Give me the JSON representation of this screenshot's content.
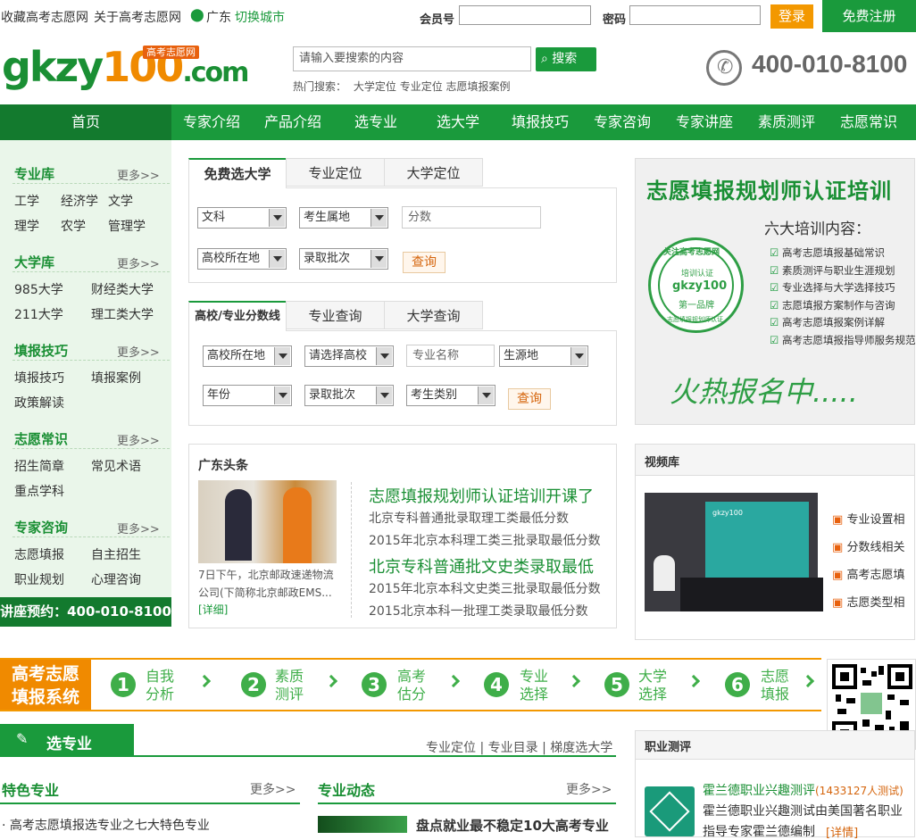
{
  "topbar": {
    "fav": "收藏高考志愿网",
    "about": "关于高考志愿网",
    "city": "广东",
    "switch_city": "切换城市",
    "member_label": "会员号",
    "password_label": "密码",
    "login": "登录",
    "register": "免费注册"
  },
  "header": {
    "logo_text_a": "gkzy",
    "logo_text_b": "100",
    "logo_text_c": ".com",
    "logo_tag": "高考志愿网",
    "search_placeholder": "请输入要搜索的内容",
    "search_button": "搜索",
    "hot_label": "热门搜索：",
    "hot_links": [
      "大学定位",
      "专业定位",
      "志愿填报案例"
    ],
    "phone": "400-010-8100"
  },
  "nav": {
    "home": "首页",
    "items": [
      "专家介绍",
      "产品介绍",
      "选专业",
      "选大学",
      "填报技巧",
      "专家咨询",
      "专家讲座",
      "素质测评",
      "志愿常识"
    ]
  },
  "sidebar": {
    "more": "更多>>",
    "sections": [
      {
        "title": "专业库",
        "links": [
          "工学",
          "经济学",
          "文学",
          "理学",
          "农学",
          "管理学"
        ]
      },
      {
        "title": "大学库",
        "links": [
          "985大学",
          "财经类大学",
          "211大学",
          "理工类大学"
        ]
      },
      {
        "title": "填报技巧",
        "links": [
          "填报技巧",
          "填报案例",
          "政策解读"
        ]
      },
      {
        "title": "志愿常识",
        "links": [
          "招生简章",
          "常见术语",
          "重点学科"
        ]
      },
      {
        "title": "专家咨询",
        "links": [
          "志愿填报",
          "自主招生",
          "职业规划",
          "心理咨询"
        ]
      }
    ],
    "footer": "讲座预约：400-010-8100"
  },
  "query1": {
    "tabs": [
      "免费选大学",
      "专业定位",
      "大学定位"
    ],
    "selects": [
      "文科",
      "考生属地",
      "高校所在地",
      "录取批次"
    ],
    "score_placeholder": "分数",
    "button": "查询"
  },
  "query2": {
    "tabs": [
      "高校/专业分数线",
      "专业查询",
      "大学查询"
    ],
    "selects": [
      "高校所在地",
      "请选择高校",
      "生源地",
      "年份",
      "录取批次",
      "考生类别"
    ],
    "major_placeholder": "专业名称",
    "button": "查询"
  },
  "news": {
    "title": "广东头条",
    "caption": "7日下午，北京邮政速递物流公司(下简称北京邮政EMS...",
    "detail": "[详细]",
    "headline1": "志愿填报规划师认证培训开课了",
    "headline2": "北京专科普通批文史类录取最低",
    "items1": [
      "北京专科普通批录取理工类最低分数",
      "2015年北京本科理工类三批录取最低分数"
    ],
    "items2": [
      "2015年北京本科文史类三批录取最低分数",
      "2015北京本科一批理工类录取最低分数"
    ]
  },
  "ad": {
    "title": "志愿填报规划师认证培训",
    "subtitle": "六大培训内容：",
    "items": [
      "高考志愿填报基础常识",
      "素质测评与职业生涯规划",
      "专业选择与大学选择技巧",
      "志愿填报方案制作与咨询",
      "高考志愿填报案例详解",
      "高考志愿填报指导师服务规范"
    ],
    "seal_top": "关注高考志愿网",
    "seal_mid": "培训认证",
    "seal_logo": "gkzy100",
    "seal_bottom": "第一品牌",
    "seal_ring": "志愿填报规划师认证",
    "cta": "火热报名中....."
  },
  "video": {
    "title": "视频库",
    "screen_logo": "gkzy100",
    "links": [
      "专业设置相",
      "分数线相关",
      "高考志愿填",
      "志愿类型相"
    ]
  },
  "banner": {
    "title_line1": "高考志愿",
    "title_line2": "填报系统",
    "steps": [
      {
        "num": "1",
        "a": "自我",
        "b": "分析"
      },
      {
        "num": "2",
        "a": "素质",
        "b": "测评"
      },
      {
        "num": "3",
        "a": "高考",
        "b": "估分"
      },
      {
        "num": "4",
        "a": "专业",
        "b": "选择"
      },
      {
        "num": "5",
        "a": "大学",
        "b": "选择"
      },
      {
        "num": "6",
        "a": "志愿",
        "b": "填报"
      }
    ]
  },
  "bottom": {
    "section_title": "选专业",
    "links": [
      "专业定位",
      "专业目录",
      "梯度选大学"
    ],
    "sep": "|",
    "left_title": "特色专业",
    "left_more": "更多>>",
    "left_item": "高考志愿填报选专业之七大特色专业",
    "mid_title": "专业动态",
    "mid_more": "更多>>",
    "mid_item": "盘点就业最不稳定10大高考专业",
    "career_title": "职业测评",
    "career_link": "霍兰德职业兴趣测评",
    "career_count": "(1433127人测试)",
    "career_desc": "霍兰德职业兴趣测试由美国著名职业",
    "career_desc2": "指导专家霍兰德编制",
    "career_detail": "[详情]"
  },
  "colors": {
    "green": "#1a9a3c",
    "dark_green": "#137a2e",
    "orange": "#f39800"
  }
}
